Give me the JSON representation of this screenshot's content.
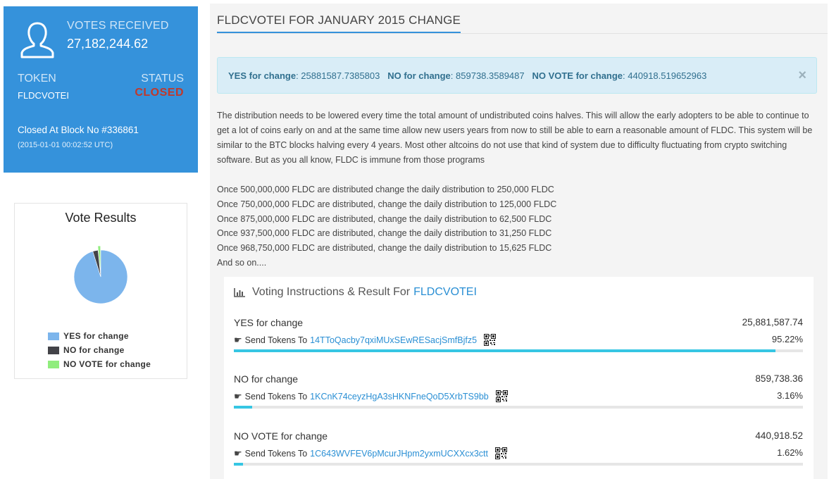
{
  "stats": {
    "votes_received_label": "VOTES RECEIVED",
    "votes_received_value": "27,182,244.62",
    "token_label": "TOKEN",
    "token_value": "FLDCVOTEI",
    "status_label": "STATUS",
    "status_value": "CLOSED",
    "closed_block": "Closed At Block No #336861",
    "closed_date": "(2015-01-01 00:02:52 UTC)"
  },
  "vote_results": {
    "title": "Vote Results",
    "legend": [
      {
        "label": "YES for change",
        "color": "#7cb5ec",
        "share": 95.22
      },
      {
        "label": "NO for change",
        "color": "#434348",
        "share": 3.16
      },
      {
        "label": "NO VOTE for change",
        "color": "#90ed7d",
        "share": 1.62
      }
    ]
  },
  "panel": {
    "title": "FLDCVOTEI FOR JANUARY 2015 CHANGE",
    "alert": {
      "yes_label": "YES for change",
      "yes_value": ": 25881587.7385803",
      "no_label": "NO for change",
      "no_value": ": 859738.3589487",
      "novote_label": "NO VOTE for change",
      "novote_value": ": 440918.519652963",
      "close": "×"
    },
    "description": "The distribution needs to be lowered every time the total amount of undistributed coins halves. This will allow the early adopters to be able to continue to get a lot of coins early on and at the same time allow new users years from now to still be able to earn a reasonable amount of FLDC. This system will be similar to the BTC blocks halving every 4 years. Most other altcoins do not use that kind of system due to difficulty fluctuating from crypto switching software. But as you all know, FLDC is immune from those programs",
    "distribution_lines": [
      "Once 500,000,000 FLDC are distributed change the daily distribution to 250,000 FLDC",
      "Once 750,000,000 FLDC are distributed, change the daily distribution to 125,000 FLDC",
      "Once 875,000,000 FLDC are distributed, change the daily distribution to 62,500 FLDC",
      "Once 937,500,000 FLDC are distributed, change the daily distribution to 31,250 FLDC",
      "Once 968,750,000 FLDC are distributed, change the daily distribution to 15,625 FLDC",
      "And so on...."
    ]
  },
  "voting": {
    "title_prefix": "Voting Instructions & Result For",
    "title_token": "FLDCVOTEI",
    "send_label": "Send Tokens To",
    "options": [
      {
        "name": "YES for change",
        "votes": "25,881,587.74",
        "address": "14TToQacby7qxiMUxSEwRESacjSmfBjfz5",
        "percent": "95.22%",
        "fill": 0.9522
      },
      {
        "name": "NO for change",
        "votes": "859,738.36",
        "address": "1KCnK74ceyzHgA3sHKNFneQoD5XrbTS9bb",
        "percent": "3.16%",
        "fill": 0.0316
      },
      {
        "name": "NO VOTE for change",
        "votes": "440,918.52",
        "address": "1C643WVFEV6pMcurJHpm2yxmUCXXcx3ctt",
        "percent": "1.62%",
        "fill": 0.0162
      }
    ]
  }
}
